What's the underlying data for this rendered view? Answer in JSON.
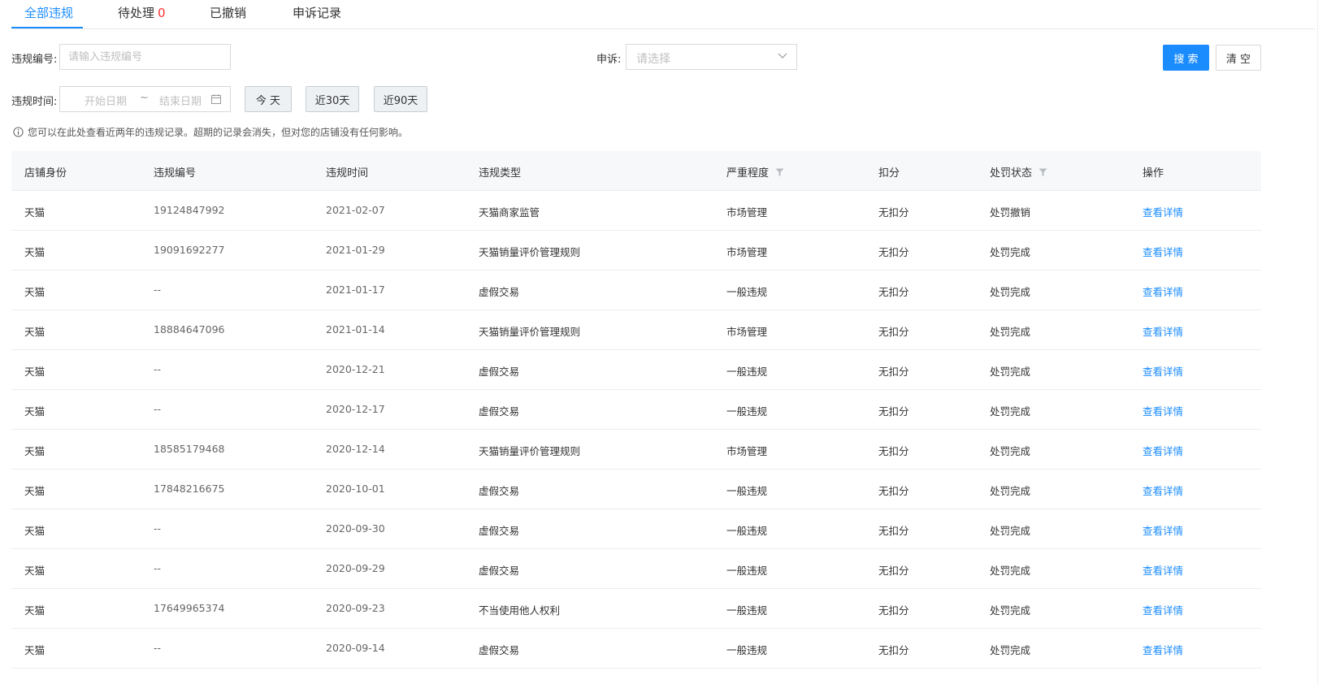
{
  "tabs": [
    {
      "label": "全部违规",
      "count": ""
    },
    {
      "label": "待处理",
      "count": "0"
    },
    {
      "label": "已撤销",
      "count": ""
    },
    {
      "label": "申诉记录",
      "count": ""
    }
  ],
  "filters": {
    "violation_no_label": "违规编号:",
    "violation_no_placeholder": "请输入违规编号",
    "appeal_label": "申诉:",
    "appeal_placeholder": "请选择",
    "time_label": "违规时间:",
    "start_placeholder": "开始日期",
    "range_sep": "~",
    "end_placeholder": "结束日期",
    "today": "今 天",
    "last30": "近30天",
    "last90": "近90天",
    "search": "搜 索",
    "clear": "清 空"
  },
  "notice": "您可以在此处查看近两年的违规记录。超期的记录会消失，但对您的店铺没有任何影响。",
  "table": {
    "headers": [
      "店铺身份",
      "违规编号",
      "违规时间",
      "违规类型",
      "严重程度",
      "扣分",
      "处罚状态",
      "操作"
    ],
    "rows": [
      [
        "天猫",
        "19124847992",
        "2021-02-07",
        "天猫商家监管",
        "市场管理",
        "无扣分",
        "处罚撤销",
        "查看详情"
      ],
      [
        "天猫",
        "19091692277",
        "2021-01-29",
        "天猫销量评价管理规则",
        "市场管理",
        "无扣分",
        "处罚完成",
        "查看详情"
      ],
      [
        "天猫",
        "--",
        "2021-01-17",
        "虚假交易",
        "一般违规",
        "无扣分",
        "处罚完成",
        "查看详情"
      ],
      [
        "天猫",
        "18884647096",
        "2021-01-14",
        "天猫销量评价管理规则",
        "市场管理",
        "无扣分",
        "处罚完成",
        "查看详情"
      ],
      [
        "天猫",
        "--",
        "2020-12-21",
        "虚假交易",
        "一般违规",
        "无扣分",
        "处罚完成",
        "查看详情"
      ],
      [
        "天猫",
        "--",
        "2020-12-17",
        "虚假交易",
        "一般违规",
        "无扣分",
        "处罚完成",
        "查看详情"
      ],
      [
        "天猫",
        "18585179468",
        "2020-12-14",
        "天猫销量评价管理规则",
        "市场管理",
        "无扣分",
        "处罚完成",
        "查看详情"
      ],
      [
        "天猫",
        "17848216675",
        "2020-10-01",
        "虚假交易",
        "一般违规",
        "无扣分",
        "处罚完成",
        "查看详情"
      ],
      [
        "天猫",
        "--",
        "2020-09-30",
        "虚假交易",
        "一般违规",
        "无扣分",
        "处罚完成",
        "查看详情"
      ],
      [
        "天猫",
        "--",
        "2020-09-29",
        "虚假交易",
        "一般违规",
        "无扣分",
        "处罚完成",
        "查看详情"
      ],
      [
        "天猫",
        "17649965374",
        "2020-09-23",
        "不当使用他人权利",
        "一般违规",
        "无扣分",
        "处罚完成",
        "查看详情"
      ],
      [
        "天猫",
        "--",
        "2020-09-14",
        "虚假交易",
        "一般违规",
        "无扣分",
        "处罚完成",
        "查看详情"
      ]
    ]
  },
  "colors": {
    "accent": "#1a8cfe",
    "alert": "#ff3333",
    "header_bg": "#f7f8fa"
  }
}
